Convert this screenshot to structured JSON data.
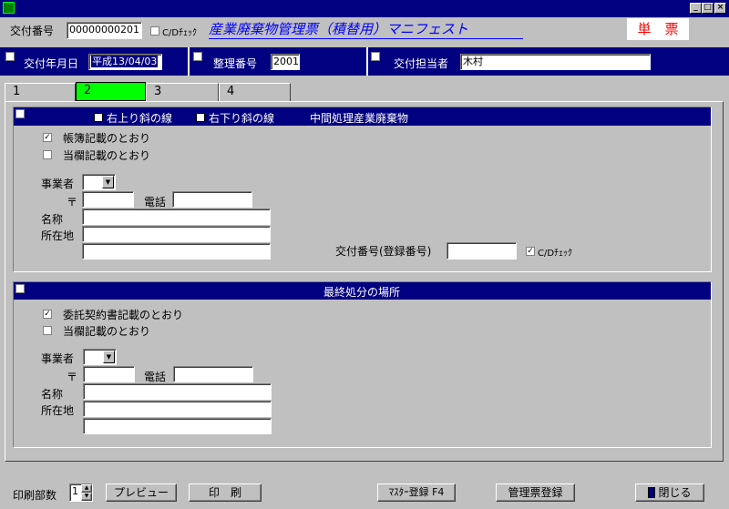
{
  "header": {
    "issue_no_label": "交付番号",
    "issue_no_value": "00000000201",
    "cd_check_label": "C/Dﾁｪｯｸ",
    "title": "産業廃棄物管理票（積替用）マニフェスト",
    "single_label": "単　票"
  },
  "info_bar": {
    "issue_date_label": "交付年月日",
    "issue_date_value": "平成13/04/03",
    "ref_no_label": "整理番号",
    "ref_no_value": "2001",
    "person_label": "交付担当者",
    "person_value": "木村"
  },
  "tabs": [
    "1",
    "2",
    "3",
    "4"
  ],
  "section1": {
    "check_up_label": "右上り斜の線",
    "check_down_label": "右下り斜の線",
    "title": "中間処理産業廃棄物",
    "opt1_label": "帳簿記載のとおり",
    "opt2_label": "当欄記載のとおり",
    "business_label": "事業者",
    "postal_label": "〒",
    "phone_label": "電話",
    "name_label": "名称",
    "address_label": "所在地",
    "reg_no_label": "交付番号(登録番号)",
    "cd_check_label": "C/Dﾁｪｯｸ"
  },
  "section2": {
    "title": "最終処分の場所",
    "opt1_label": "委託契約書記載のとおり",
    "opt2_label": "当欄記載のとおり",
    "business_label": "事業者",
    "postal_label": "〒",
    "phone_label": "電話",
    "name_label": "名称",
    "address_label": "所在地"
  },
  "footer": {
    "copies_label": "印刷部数",
    "copies_value": "1",
    "preview_label": "プレビュー",
    "print_label": "印　刷",
    "master_label": "ﾏｽﾀｰ登録 F4",
    "register_label": "管理票登録",
    "close_label": "閉じる"
  },
  "colors": {
    "navy": "#000080",
    "active_tab": "#00ff00",
    "title_blue": "#0000ff",
    "single_red": "#ff0000"
  }
}
